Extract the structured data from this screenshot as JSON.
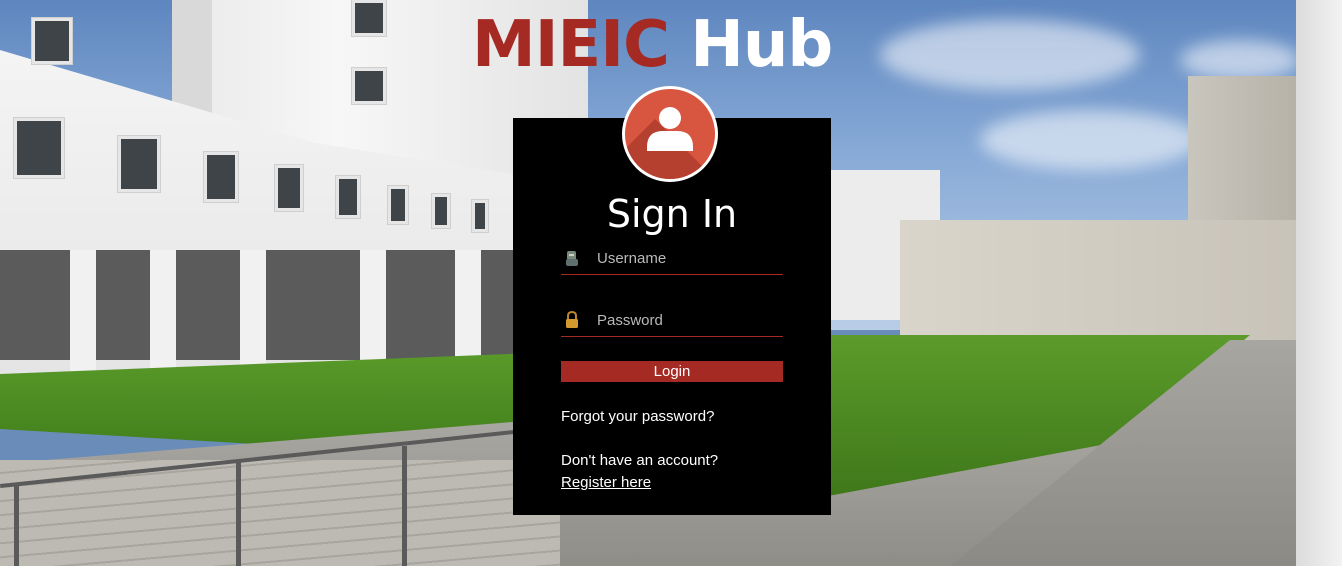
{
  "header": {
    "brand_first": "MIEIC",
    "brand_second": " Hub"
  },
  "login": {
    "heading": "Sign In",
    "username_placeholder": "Username",
    "password_placeholder": "Password",
    "login_label": "Login",
    "forgot_label": "Forgot your password?",
    "no_account_label": "Don't have an account?",
    "register_label": "Register here"
  },
  "icons": {
    "avatar": "user-avatar-icon",
    "username": "user-icon",
    "password": "lock-icon"
  },
  "colors": {
    "brand_red": "#a52a24",
    "avatar_red": "#d8553f",
    "card_background": "#000000"
  }
}
